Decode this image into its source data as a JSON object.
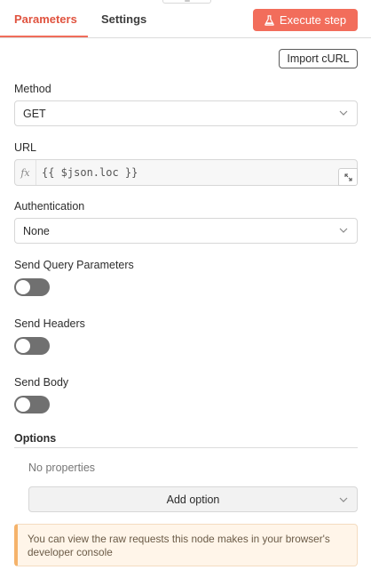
{
  "tabs": {
    "parameters": "Parameters",
    "settings": "Settings"
  },
  "header": {
    "execute_label": "Execute step"
  },
  "import_curl": "Import cURL",
  "method": {
    "label": "Method",
    "value": "GET"
  },
  "url": {
    "label": "URL",
    "expression_tag": "fx",
    "value": "{{ $json.loc }}"
  },
  "authentication": {
    "label": "Authentication",
    "value": "None"
  },
  "send_query": {
    "label": "Send Query Parameters",
    "enabled": false
  },
  "send_headers": {
    "label": "Send Headers",
    "enabled": false
  },
  "send_body": {
    "label": "Send Body",
    "enabled": false
  },
  "options": {
    "title": "Options",
    "empty_text": "No properties",
    "add_label": "Add option"
  },
  "notice": {
    "text": "You can view the raw requests this node makes in your browser's developer console"
  },
  "colors": {
    "accent": "#f26d5b",
    "active_tab": "#e0533f",
    "toggle_off": "#707070",
    "notice_bg": "#fff5e9",
    "notice_border": "#f5b36b"
  },
  "icons": {
    "execute": "flask-icon",
    "dropdown": "chevron-down-icon",
    "expand": "expand-icon"
  }
}
